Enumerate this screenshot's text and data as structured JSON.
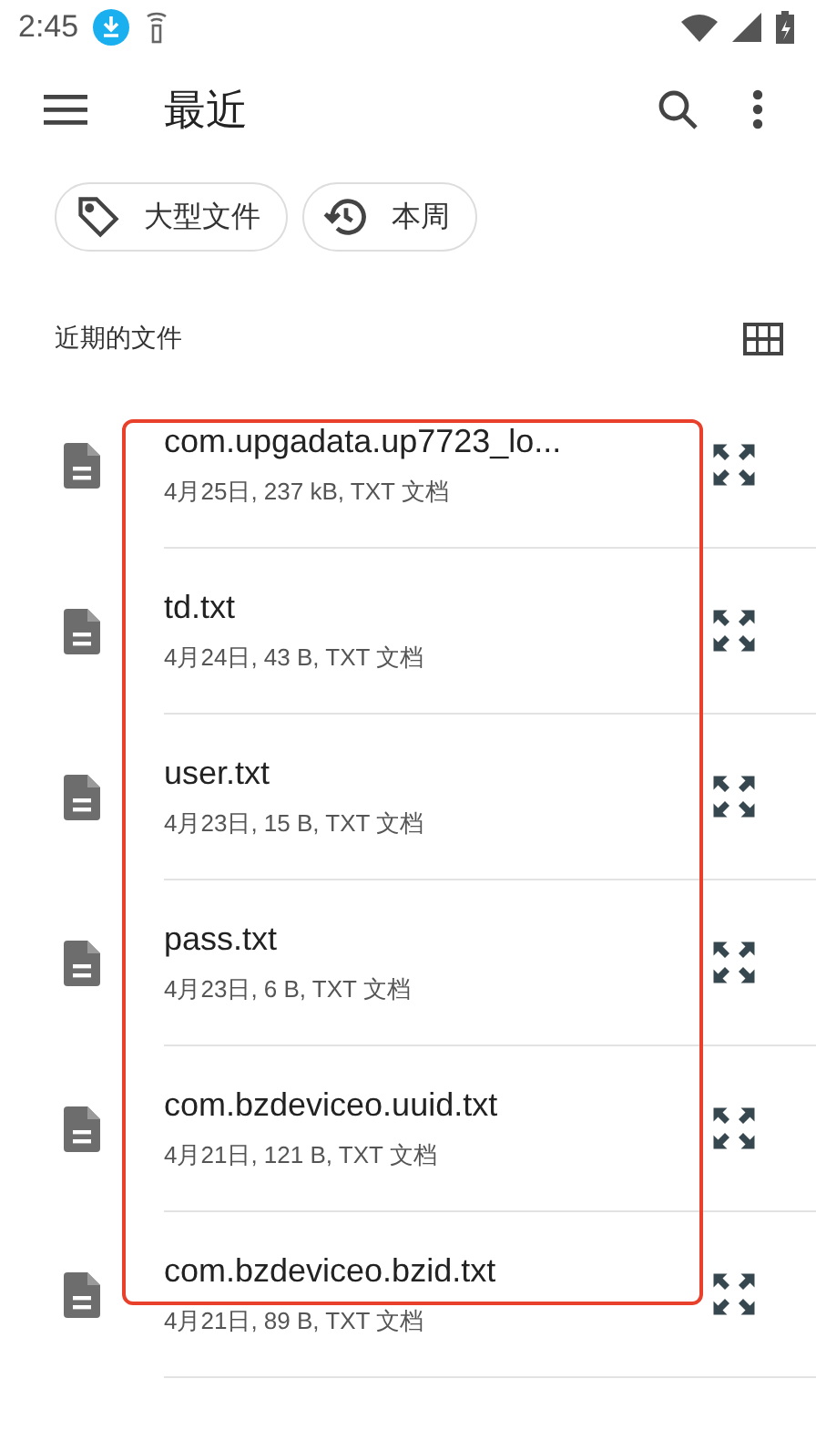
{
  "status_bar": {
    "time": "2:45"
  },
  "toolbar": {
    "title": "最近"
  },
  "chips": [
    {
      "kind": "tag",
      "label": "大型文件"
    },
    {
      "kind": "history",
      "label": "本周"
    }
  ],
  "section": {
    "title": "近期的文件"
  },
  "files": [
    {
      "name": "com.upgadata.up7723_lo...",
      "meta": "4月25日, 237 kB, TXT 文档"
    },
    {
      "name": "td.txt",
      "meta": "4月24日, 43 B, TXT 文档"
    },
    {
      "name": "user.txt",
      "meta": "4月23日, 15 B, TXT 文档"
    },
    {
      "name": "pass.txt",
      "meta": "4月23日, 6 B, TXT 文档"
    },
    {
      "name": "com.bzdeviceo.uuid.txt",
      "meta": "4月21日, 121 B, TXT 文档"
    },
    {
      "name": "com.bzdeviceo.bzid.txt",
      "meta": "4月21日, 89 B, TXT 文档"
    }
  ]
}
